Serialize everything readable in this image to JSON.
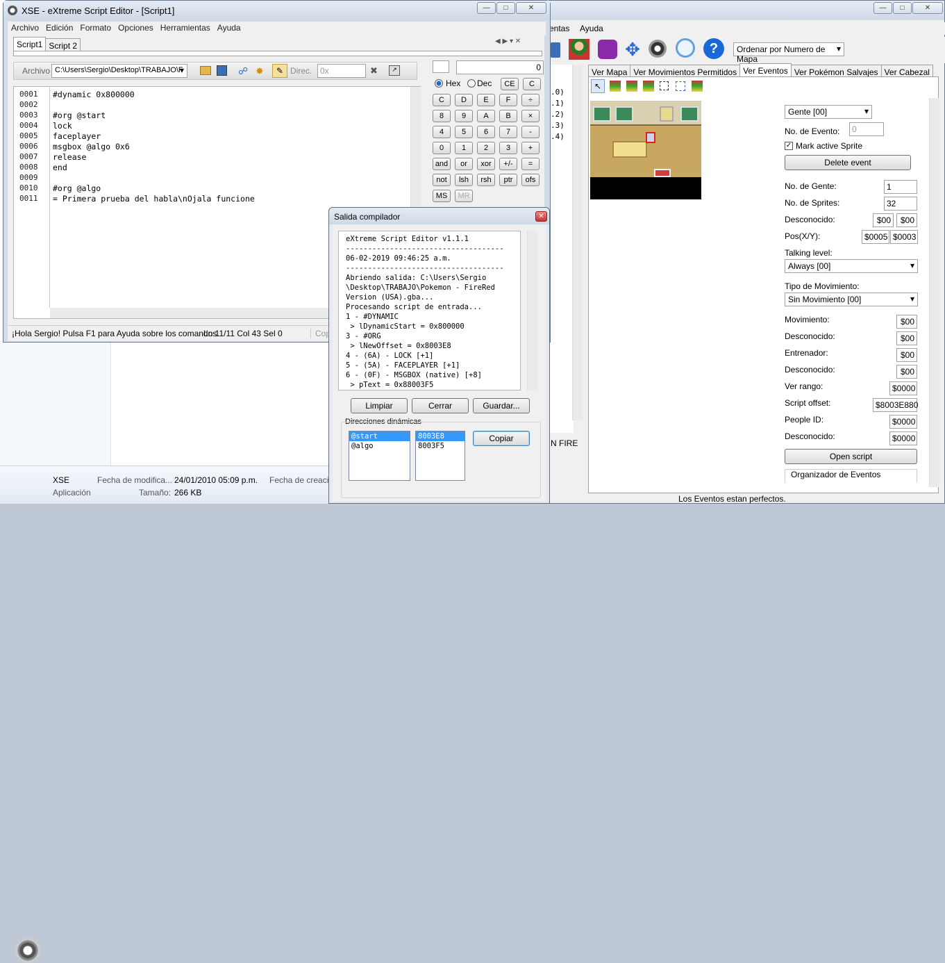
{
  "explorer": {
    "file_name": "XSE",
    "file_type": "Aplicación",
    "modified_label": "Fecha de modifica...",
    "modified_value": "24/01/2010 05:09 p.m.",
    "created_label": "Fecha de creació",
    "size_label": "Tamaño:",
    "size_value": "266 KB"
  },
  "amap": {
    "menu": [
      "entas",
      "Ayuda"
    ],
    "sort_combo": "Ordenar por Numero de Mapa",
    "tabs": [
      "Ver Mapa",
      "Ver Movimientos Permitidos",
      "Ver Eventos",
      "Ver Pokémon Salvajes",
      "Ver Cabezal"
    ],
    "left_list": [
      ".0)",
      ".1)",
      ".2)",
      ".3)",
      ".4)"
    ],
    "left_bottom": "N FIRE",
    "status": "Los Eventos estan perfectos.",
    "panel": {
      "event_type": "Gente [00]",
      "event_no_label": "No. de Evento:",
      "event_no": "0",
      "mark_label": "Mark active Sprite",
      "delete_btn": "Delete event",
      "gente_label": "No. de Gente:",
      "gente": "1",
      "sprites_label": "No. de Sprites:",
      "sprites": "32",
      "unk1_label": "Desconocido:",
      "unk1_a": "$00",
      "unk1_b": "$00",
      "pos_label": "Pos(X/Y):",
      "pos_x": "$0005",
      "pos_y": "$0003",
      "talking_label": "Talking level:",
      "talking": "Always [00]",
      "mov_type_label": "Tipo de Movimiento:",
      "mov_type": "Sin Movimiento [00]",
      "mov_label": "Movimiento:",
      "mov": "$00",
      "unk2_label": "Desconocido:",
      "unk2": "$00",
      "trainer_label": "Entrenador:",
      "trainer": "$00",
      "unk3_label": "Desconocido:",
      "unk3": "$00",
      "range_label": "Ver rango:",
      "range": "$0000",
      "script_label": "Script offset:",
      "script": "$8003E880",
      "people_label": "People ID:",
      "people": "$0000",
      "unk4_label": "Desconocido:",
      "unk4": "$0000",
      "open_btn": "Open script",
      "organizer": "Organizador de Eventos"
    }
  },
  "xse": {
    "title": "XSE - eXtreme Script Editor - [Script1]",
    "menu": [
      "Archivo",
      "Edición",
      "Formato",
      "Opciones",
      "Herramientas",
      "Ayuda"
    ],
    "tabs": [
      "Script1",
      "Script 2"
    ],
    "archivo_label": "Archivo",
    "archivo_path": "C:\\Users\\Sergio\\Desktop\\TRABAJO\\F",
    "direc_label": "Direc.",
    "direc_value": "0x",
    "line_numbers": [
      "0001",
      "0002",
      "0003",
      "0004",
      "0005",
      "0006",
      "0007",
      "0008",
      "0009",
      "0010",
      "0011"
    ],
    "code_lines": [
      "#dynamic 0x800000",
      "",
      "#org @start",
      "lock",
      "faceplayer",
      "msgbox @algo 0x6",
      "release",
      "end",
      "",
      "#org @algo",
      "= Primera prueba del habla\\nOjala funcione"
    ],
    "status_hint": "¡Hola Sergio! Pulsa F1 para Ayuda sobre los comandos.",
    "status_pos": "Ln 11/11  Col 43  Sel 0",
    "status_copy": "Copy",
    "calc_display": "0",
    "hex_label": "Hex",
    "dec_label": "Dec",
    "calc_keys": [
      [
        "CE",
        "C"
      ],
      [
        "C",
        "D",
        "E",
        "F",
        "÷"
      ],
      [
        "8",
        "9",
        "A",
        "B",
        "×"
      ],
      [
        "4",
        "5",
        "6",
        "7",
        "-"
      ],
      [
        "0",
        "1",
        "2",
        "3",
        "+"
      ],
      [
        "and",
        "or",
        "xor",
        "+/-",
        "="
      ],
      [
        "not",
        "lsh",
        "rsh",
        "ptr",
        "ofs"
      ],
      [
        "MS",
        "MR"
      ]
    ]
  },
  "output": {
    "title": "Salida compilador",
    "lines": [
      "eXtreme Script Editor v1.1.1",
      "------------------------------------",
      "06-02-2019 09:46:25 a.m.",
      "------------------------------------",
      "Abriendo salida: C:\\Users\\Sergio",
      "\\Desktop\\TRABAJO\\Pokemon - FireRed",
      "Version (USA).gba...",
      "Procesando script de entrada...",
      "1 - #DYNAMIC",
      " > lDynamicStart = 0x800000",
      "3 - #ORG",
      " > lNewOffset = 0x8003E8",
      "4 - (6A) - LOCK [+1]",
      "5 - (5A) - FACEPLAYER [+1]",
      "6 - (0F) - MSGBOX (native) [+8]",
      " > pText = 0x88003F5"
    ],
    "btn_clear": "Limpiar",
    "btn_close": "Cerrar",
    "btn_save": "Guardar...",
    "dyn_label": "Direcciones dinámicas",
    "dyn_names": [
      "@start",
      "@algo"
    ],
    "dyn_values": [
      "8003E8",
      "8003F5"
    ],
    "btn_copy": "Copiar"
  },
  "colors": {
    "accent": "#3399ff",
    "map_floor": "#c8a860",
    "map_black": "#000000"
  }
}
